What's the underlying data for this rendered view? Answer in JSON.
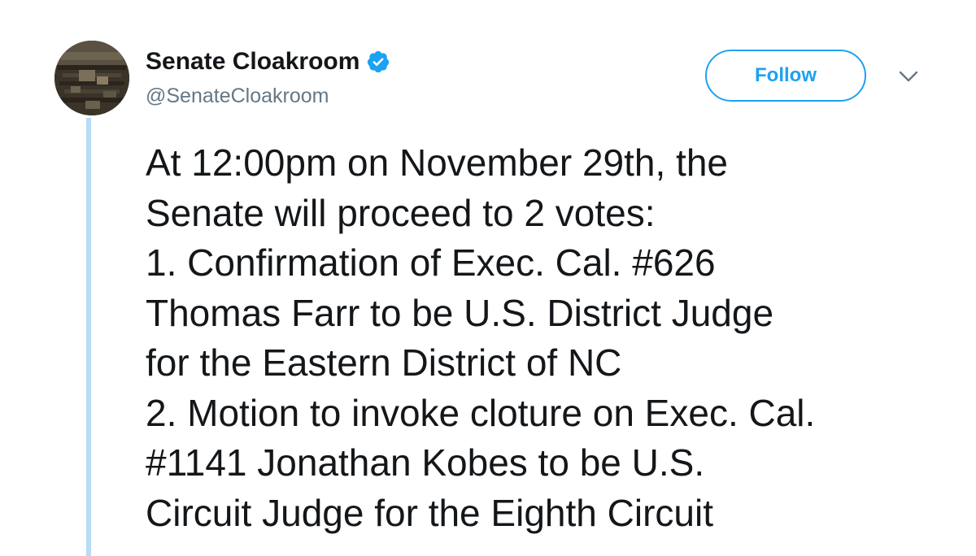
{
  "author": {
    "display_name": "Senate Cloakroom",
    "handle": "@SenateCloakroom",
    "verified": true
  },
  "actions": {
    "follow_label": "Follow"
  },
  "tweet": {
    "lines": [
      "At 12:00pm on November 29th, the",
      "Senate will proceed to 2 votes:",
      "1. Confirmation of Exec. Cal. #626",
      "Thomas Farr to be U.S. District Judge",
      "for the Eastern District of NC",
      "2. Motion to invoke cloture on Exec. Cal.",
      "#1141 Jonathan Kobes to be U.S.",
      "Circuit Judge for the Eighth Circuit"
    ]
  },
  "icons": {
    "verified": "verified-badge-icon",
    "menu": "chevron-down-icon"
  },
  "colors": {
    "accent": "#1da1f2",
    "thread_line": "#b7dcf5",
    "text": "#14171a",
    "secondary_text": "#657786"
  }
}
